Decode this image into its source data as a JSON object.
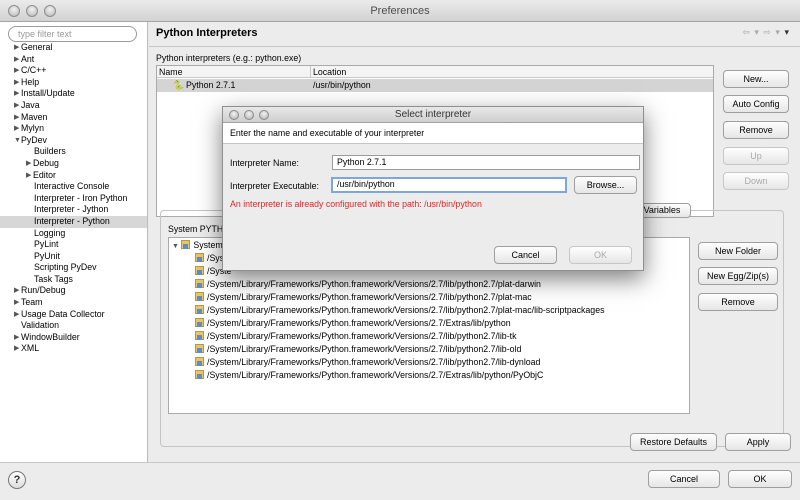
{
  "window": {
    "title": "Preferences"
  },
  "sidebar": {
    "filter_placeholder": "type filter text",
    "items": [
      {
        "label": "General",
        "level": 0,
        "arrow": "right",
        "selected": false
      },
      {
        "label": "Ant",
        "level": 0,
        "arrow": "right",
        "selected": false
      },
      {
        "label": "C/C++",
        "level": 0,
        "arrow": "right",
        "selected": false
      },
      {
        "label": "Help",
        "level": 0,
        "arrow": "right",
        "selected": false
      },
      {
        "label": "Install/Update",
        "level": 0,
        "arrow": "right",
        "selected": false
      },
      {
        "label": "Java",
        "level": 0,
        "arrow": "right",
        "selected": false
      },
      {
        "label": "Maven",
        "level": 0,
        "arrow": "right",
        "selected": false
      },
      {
        "label": "Mylyn",
        "level": 0,
        "arrow": "right",
        "selected": false
      },
      {
        "label": "PyDev",
        "level": 0,
        "arrow": "down",
        "selected": false
      },
      {
        "label": "Builders",
        "level": 2,
        "arrow": "",
        "selected": false
      },
      {
        "label": "Debug",
        "level": 1,
        "arrow": "right",
        "selected": false
      },
      {
        "label": "Editor",
        "level": 1,
        "arrow": "right",
        "selected": false
      },
      {
        "label": "Interactive Console",
        "level": 2,
        "arrow": "",
        "selected": false
      },
      {
        "label": "Interpreter - Iron Python",
        "level": 2,
        "arrow": "",
        "selected": false
      },
      {
        "label": "Interpreter - Jython",
        "level": 2,
        "arrow": "",
        "selected": false
      },
      {
        "label": "Interpreter - Python",
        "level": 2,
        "arrow": "",
        "selected": true
      },
      {
        "label": "Logging",
        "level": 2,
        "arrow": "",
        "selected": false
      },
      {
        "label": "PyLint",
        "level": 2,
        "arrow": "",
        "selected": false
      },
      {
        "label": "PyUnit",
        "level": 2,
        "arrow": "",
        "selected": false
      },
      {
        "label": "Scripting PyDev",
        "level": 2,
        "arrow": "",
        "selected": false
      },
      {
        "label": "Task Tags",
        "level": 2,
        "arrow": "",
        "selected": false
      },
      {
        "label": "Run/Debug",
        "level": 0,
        "arrow": "right",
        "selected": false
      },
      {
        "label": "Team",
        "level": 0,
        "arrow": "right",
        "selected": false
      },
      {
        "label": "Usage Data Collector",
        "level": 0,
        "arrow": "right",
        "selected": false
      },
      {
        "label": "Validation",
        "level": 1,
        "arrow": "",
        "selected": false
      },
      {
        "label": "WindowBuilder",
        "level": 0,
        "arrow": "right",
        "selected": false
      },
      {
        "label": "XML",
        "level": 0,
        "arrow": "right",
        "selected": false
      }
    ]
  },
  "page": {
    "title": "Python Interpreters",
    "interpreters_label": "Python interpreters (e.g.: python.exe)",
    "columns": [
      "Name",
      "Location"
    ],
    "rows": [
      {
        "name": "Python 2.7.1",
        "location": "/usr/bin/python"
      }
    ],
    "buttons": {
      "new": "New...",
      "auto_config": "Auto Config",
      "remove": "Remove",
      "up": "Up",
      "down": "Down"
    },
    "tab_partial": "Variables",
    "group_label": "System PYTHO",
    "libs_root": "System",
    "libs": [
      "/Syste",
      "/Syste",
      "/System/Library/Frameworks/Python.framework/Versions/2.7/lib/python2.7/plat-darwin",
      "/System/Library/Frameworks/Python.framework/Versions/2.7/lib/python2.7/plat-mac",
      "/System/Library/Frameworks/Python.framework/Versions/2.7/lib/python2.7/plat-mac/lib-scriptpackages",
      "/System/Library/Frameworks/Python.framework/Versions/2.7/Extras/lib/python",
      "/System/Library/Frameworks/Python.framework/Versions/2.7/lib/python2.7/lib-tk",
      "/System/Library/Frameworks/Python.framework/Versions/2.7/lib/python2.7/lib-old",
      "/System/Library/Frameworks/Python.framework/Versions/2.7/lib/python2.7/lib-dynload",
      "/System/Library/Frameworks/Python.framework/Versions/2.7/Extras/lib/python/PyObjC"
    ],
    "lib_buttons": {
      "new_folder": "New Folder",
      "new_egg": "New Egg/Zip(s)",
      "remove": "Remove"
    },
    "restore_defaults": "Restore Defaults",
    "apply": "Apply"
  },
  "footer": {
    "help": "?",
    "cancel": "Cancel",
    "ok": "OK"
  },
  "dialog": {
    "title": "Select interpreter",
    "header": "Enter the name and executable of your interpreter",
    "name_label": "Interpreter Name:",
    "name_value": "Python 2.7.1",
    "exe_label": "Interpreter Executable:",
    "exe_value": "/usr/bin/python",
    "browse": "Browse...",
    "error": "An interpreter is already configured with the path: /usr/bin/python",
    "cancel": "Cancel",
    "ok": "OK"
  }
}
